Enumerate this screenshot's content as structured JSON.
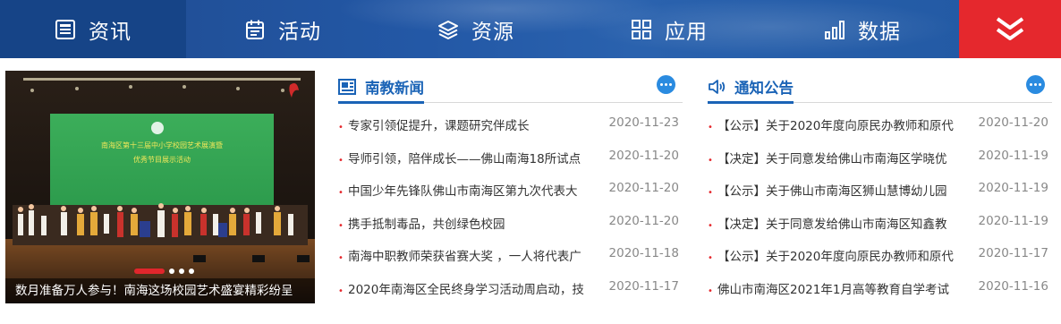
{
  "nav": {
    "items": [
      {
        "label": "资讯",
        "icon": "news-icon"
      },
      {
        "label": "活动",
        "icon": "calendar-icon"
      },
      {
        "label": "资源",
        "icon": "layers-icon"
      },
      {
        "label": "应用",
        "icon": "grid-icon"
      },
      {
        "label": "数据",
        "icon": "bar-chart-icon"
      }
    ],
    "more_icon": "double-chevron-down-icon",
    "colors": {
      "bar": "#2358a6",
      "active": "#164487",
      "more": "#e5282d"
    }
  },
  "slideshow": {
    "caption": "数月准备万人参与！南海这场校园艺术盛宴精彩纷呈",
    "banner_line1": "南海区第十三届中小学校园艺术展演暨",
    "banner_line2": "优秀节目展示活动",
    "dots": 3,
    "active_dot": 0
  },
  "news": {
    "title": "南教新闻",
    "icon": "newspaper-icon",
    "items": [
      {
        "title": "专家引领促提升，课题研究伴成长",
        "date": "2020-11-23"
      },
      {
        "title": "导师引领，陪伴成长——佛山南海18所试点",
        "date": "2020-11-20"
      },
      {
        "title": "中国少年先锋队佛山市南海区第九次代表大",
        "date": "2020-11-20"
      },
      {
        "title": "携手抵制毒品，共创绿色校园",
        "date": "2020-11-20"
      },
      {
        "title": "南海中职教师荣获省赛大奖 ，一人将代表广",
        "date": "2020-11-18"
      },
      {
        "title": "2020年南海区全民终身学习活动周启动，技",
        "date": "2020-11-17"
      }
    ]
  },
  "notices": {
    "title": "通知公告",
    "icon": "speaker-icon",
    "items": [
      {
        "title": "【公示】关于2020年度向原民办教师和原代",
        "date": "2020-11-20"
      },
      {
        "title": "【决定】关于同意发给佛山市南海区学晓优",
        "date": "2020-11-19"
      },
      {
        "title": "【公示】关于佛山市南海区狮山慧博幼儿园",
        "date": "2020-11-19"
      },
      {
        "title": "【决定】关于同意发给佛山市南海区知鑫教",
        "date": "2020-11-19"
      },
      {
        "title": "【公示】关于2020年度向原民办教师和原代",
        "date": "2020-11-17"
      },
      {
        "title": "佛山市南海区2021年1月高等教育自学考试",
        "date": "2020-11-16"
      }
    ]
  }
}
